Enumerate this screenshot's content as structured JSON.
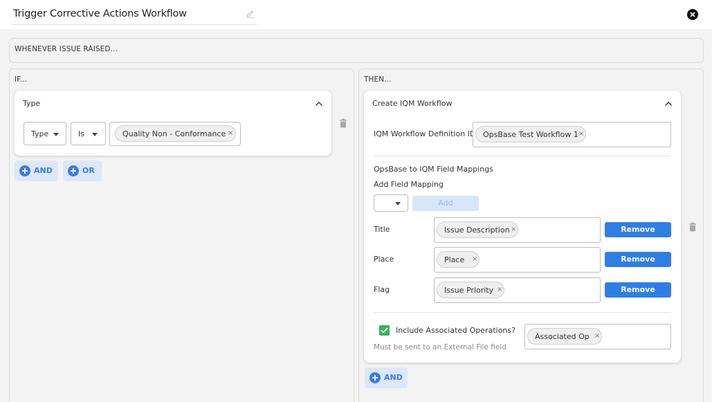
{
  "header": {
    "title": "Trigger Corrective Actions Workflow"
  },
  "trigger": {
    "label": "WHENEVER ISSUE RAISED..."
  },
  "if_panel": {
    "label": "IF...",
    "condition": {
      "title": "Type",
      "field_select": "Type",
      "operator_select": "Is",
      "value_chip": "Quality Non - Conformance"
    },
    "and_label": "AND",
    "or_label": "OR"
  },
  "then_panel": {
    "label": "THEN...",
    "action": {
      "title": "Create IQM Workflow",
      "definition_label": "IQM Workflow Definition ID",
      "definition_chip": "OpsBase Test Workflow 1",
      "mappings_heading": "OpsBase to IQM Field Mappings",
      "add_mapping_label": "Add Field Mapping",
      "add_button": "Add",
      "mappings": [
        {
          "label": "Title",
          "chip": "Issue Description",
          "remove": "Remove"
        },
        {
          "label": "Place",
          "chip": "Place",
          "remove": "Remove"
        },
        {
          "label": "Flag",
          "chip": "Issue Priority",
          "remove": "Remove"
        }
      ],
      "include_ops_label": "Include Associated Operations?",
      "include_ops_checked": true,
      "include_ops_hint": "Must be sent to an External File field",
      "assoc_chip": "Associated Op"
    },
    "and_label": "AND"
  },
  "colors": {
    "accent": "#2f7ee6",
    "check": "#2fb55b"
  }
}
